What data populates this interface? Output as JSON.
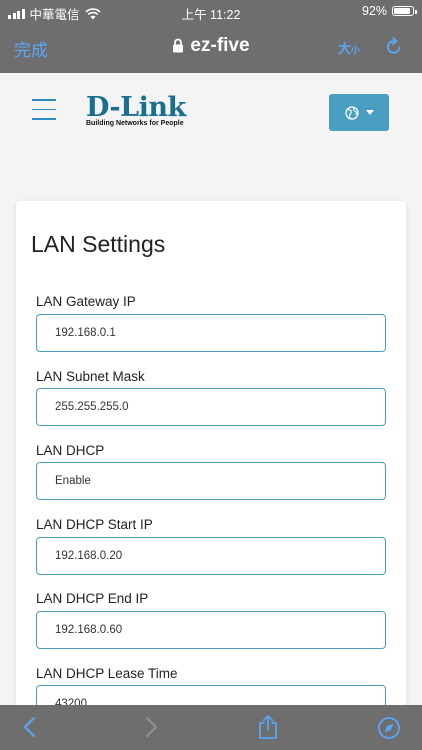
{
  "status_bar": {
    "carrier": "中華電信",
    "time": "上午 11:22",
    "battery": "92%",
    "battery_level": 0.92
  },
  "browser": {
    "done_label": "完成",
    "url": "ez-five",
    "text_size_big": "大",
    "text_size_small": "小"
  },
  "header": {
    "brand": "D-Link",
    "tagline": "Building Networks for People",
    "language_icon": "globe-icon"
  },
  "section": {
    "title": "LAN Settings",
    "fields": [
      {
        "label": "LAN Gateway IP",
        "value": "192.168.0.1"
      },
      {
        "label": "LAN Subnet Mask",
        "value": "255.255.255.0"
      },
      {
        "label": "LAN DHCP",
        "value": "Enable"
      },
      {
        "label": "LAN DHCP Start IP",
        "value": "192.168.0.20"
      },
      {
        "label": "LAN DHCP End IP",
        "value": "192.168.0.60"
      },
      {
        "label": "LAN DHCP Lease Time",
        "value": "43200"
      }
    ]
  },
  "colors": {
    "accent": "#4a9ec2",
    "browser_chrome": "#6e6e6e",
    "ios_blue": "#5aa5f5"
  }
}
